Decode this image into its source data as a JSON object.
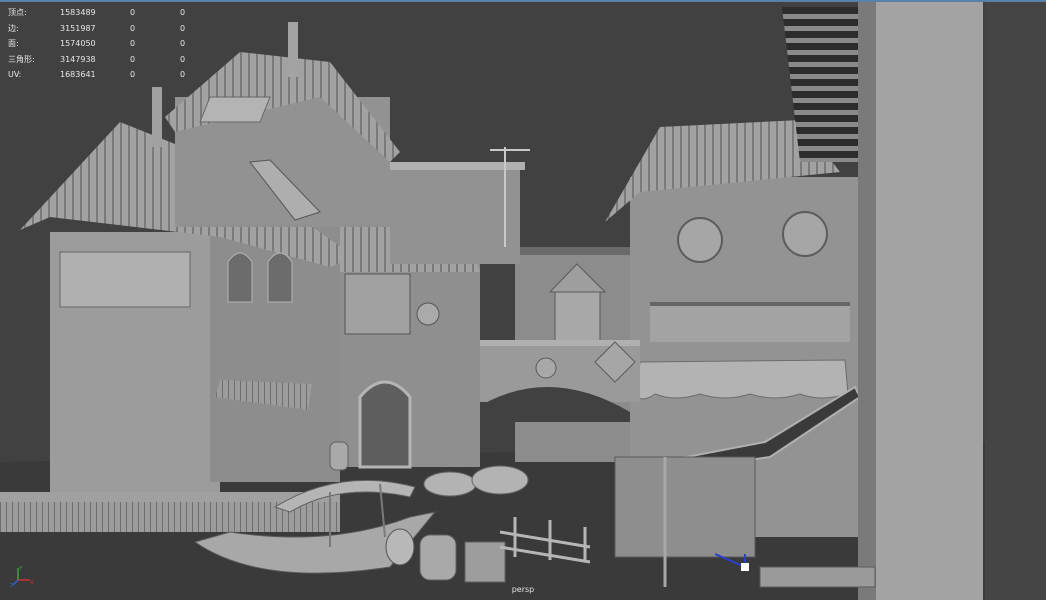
{
  "hud": {
    "rows": [
      {
        "label": "顶点:",
        "value": "1583489",
        "a": "0",
        "b": "0"
      },
      {
        "label": "边:",
        "value": "3151987",
        "a": "0",
        "b": "0"
      },
      {
        "label": "面:",
        "value": "1574050",
        "a": "0",
        "b": "0"
      },
      {
        "label": "三角形:",
        "value": "3147938",
        "a": "0",
        "b": "0"
      },
      {
        "label": "UV:",
        "value": "1683641",
        "a": "0",
        "b": "0"
      }
    ]
  },
  "viewport": {
    "camera_label": "persp"
  },
  "axis_gizmo": {
    "x_label": "X",
    "y_label": "Y",
    "z_label": "Z"
  },
  "colors": {
    "background": "#414141",
    "model": "#9a9a9a",
    "model_shadow": "#555555",
    "axis_x": "#d03030",
    "axis_y": "#30b030",
    "axis_z": "#3060d0"
  }
}
